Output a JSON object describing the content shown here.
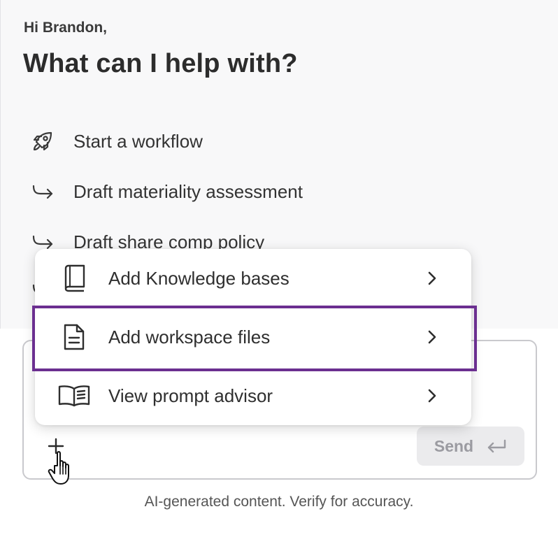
{
  "header": {
    "greeting": "Hi Brandon,",
    "headline": "What can I help with?"
  },
  "suggestions": [
    {
      "icon": "rocket-icon",
      "label": "Start a workflow"
    },
    {
      "icon": "arrow-return-right-icon",
      "label": "Draft materiality assessment"
    },
    {
      "icon": "arrow-return-right-icon",
      "label": "Draft share comp policy"
    },
    {
      "icon": "arrow-return-right-icon",
      "label": ""
    }
  ],
  "menu": {
    "items": [
      {
        "icon": "book-icon",
        "label": "Add Knowledge bases"
      },
      {
        "icon": "document-icon",
        "label": "Add workspace files",
        "highlighted": true
      },
      {
        "icon": "open-book-icon",
        "label": "View prompt advisor"
      }
    ]
  },
  "composer": {
    "add_icon": "plus-icon",
    "send_label": "Send",
    "send_icon": "return-arrow-icon"
  },
  "footer": {
    "disclaimer": "AI-generated content. Verify for accuracy."
  },
  "colors": {
    "highlight_border": "#6b2f90",
    "top_background": "#f8f8f9",
    "send_background": "#ebebed",
    "send_text": "#9b9ba1"
  }
}
